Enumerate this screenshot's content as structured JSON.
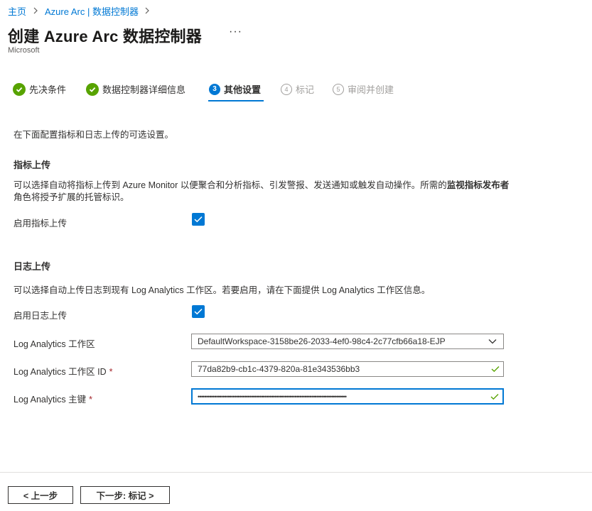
{
  "breadcrumb": {
    "home": "主页",
    "parent": "Azure Arc | 数据控制器"
  },
  "header": {
    "title": "创建 Azure Arc 数据控制器",
    "more": "···",
    "publisher": "Microsoft"
  },
  "steps": [
    {
      "label": "先决条件",
      "state": "done"
    },
    {
      "label": "数据控制器详细信息",
      "state": "done"
    },
    {
      "label": "其他设置",
      "number": "3",
      "state": "current"
    },
    {
      "label": "标记",
      "number": "4",
      "state": "future"
    },
    {
      "label": "审阅并创建",
      "number": "5",
      "state": "future"
    }
  ],
  "intro": "在下面配置指标和日志上传的可选设置。",
  "metrics": {
    "title": "指标上传",
    "desc_part1": "可以选择自动将指标上传到 Azure Monitor 以便聚合和分析指标、引发警报、发送通知或触发自动操作。所需的",
    "desc_bold": "监视指标发布者",
    "desc_part2": "角色将授予扩展的托管标识。",
    "enable_label": "启用指标上传",
    "enabled": true
  },
  "logs": {
    "title": "日志上传",
    "desc": "可以选择自动上传日志到现有 Log Analytics 工作区。若要启用，请在下面提供 Log Analytics 工作区信息。",
    "enable_label": "启用日志上传",
    "enabled": true,
    "workspace_label": "Log Analytics 工作区",
    "workspace_value": "DefaultWorkspace-3158be26-2033-4ef0-98c4-2c77cfb66a18-EJP",
    "workspace_id_label": "Log Analytics 工作区 ID",
    "workspace_id_value": "77da82b9-cb1c-4379-820a-81e343536bb3",
    "key_label": "Log Analytics 主键",
    "key_value": "•••••••••••••••••••••••••••••••••••••••••••••••••••••••••••••••••••••••••••••••••••••••••",
    "required_mark": "*"
  },
  "footer": {
    "prev": "< 上一步",
    "next": "下一步: 标记 >"
  },
  "colors": {
    "accent": "#0078d4",
    "success": "#57a300",
    "required": "#a4262c"
  }
}
